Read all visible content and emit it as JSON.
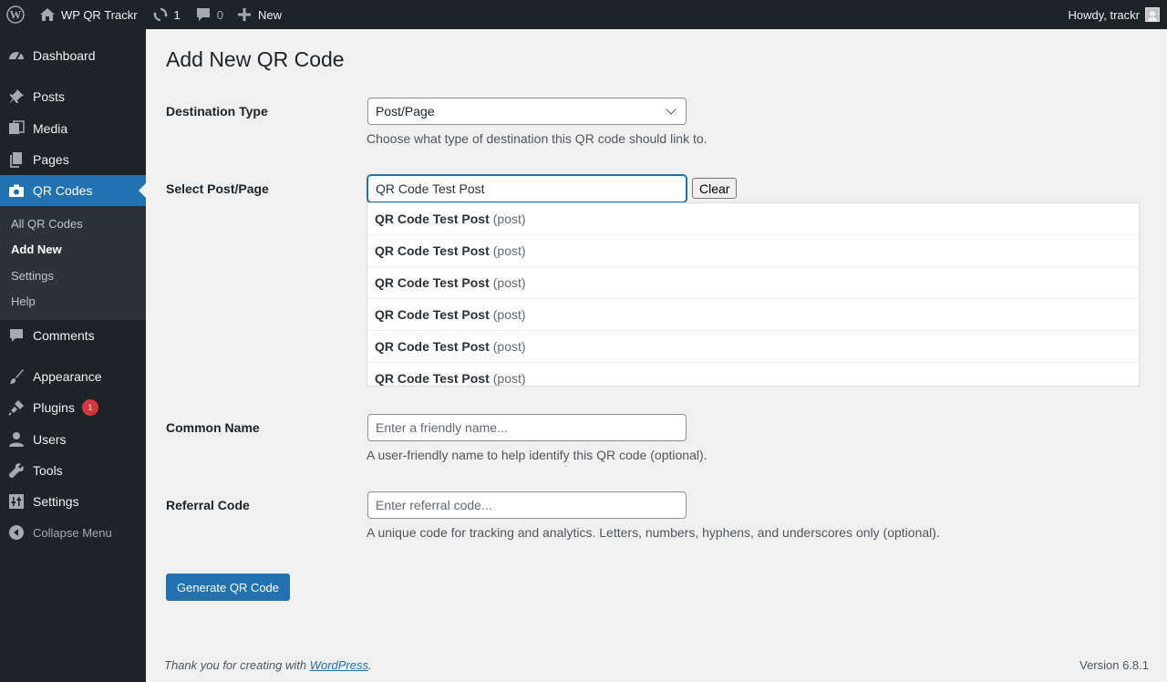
{
  "adminbar": {
    "site_name": "WP QR Trackr",
    "updates_count": "1",
    "comments_count": "0",
    "new_label": "New",
    "howdy": "Howdy, trackr"
  },
  "menu": {
    "dashboard": "Dashboard",
    "posts": "Posts",
    "media": "Media",
    "pages": "Pages",
    "qr_codes": "QR Codes",
    "submenu": [
      "All QR Codes",
      "Add New",
      "Settings",
      "Help"
    ],
    "comments": "Comments",
    "appearance": "Appearance",
    "plugins": "Plugins",
    "plugins_badge": "1",
    "users": "Users",
    "tools": "Tools",
    "settings": "Settings",
    "collapse": "Collapse Menu"
  },
  "page": {
    "title": "Add New QR Code",
    "destination_type": {
      "label": "Destination Type",
      "value": "Post/Page",
      "description": "Choose what type of destination this QR code should link to."
    },
    "select_post": {
      "label": "Select Post/Page",
      "value": "QR Code Test Post",
      "clear_label": "Clear",
      "results": [
        {
          "title": "QR Code Test Post",
          "type": "(post)"
        },
        {
          "title": "QR Code Test Post",
          "type": "(post)"
        },
        {
          "title": "QR Code Test Post",
          "type": "(post)"
        },
        {
          "title": "QR Code Test Post",
          "type": "(post)"
        },
        {
          "title": "QR Code Test Post",
          "type": "(post)"
        },
        {
          "title": "QR Code Test Post",
          "type": "(post)"
        }
      ]
    },
    "common_name": {
      "label": "Common Name",
      "placeholder": "Enter a friendly name...",
      "description": "A user-friendly name to help identify this QR code (optional)."
    },
    "referral_code": {
      "label": "Referral Code",
      "placeholder": "Enter referral code...",
      "description": "A unique code for tracking and analytics. Letters, numbers, hyphens, and underscores only (optional)."
    },
    "submit_label": "Generate QR Code"
  },
  "footer": {
    "thanks_prefix": "Thank you for creating with ",
    "wp_link": "WordPress",
    "thanks_suffix": ".",
    "version": "Version 6.8.1"
  },
  "colors": {
    "accent": "#2271b1",
    "adminbar_bg": "#1d2327",
    "badge": "#d63638"
  }
}
